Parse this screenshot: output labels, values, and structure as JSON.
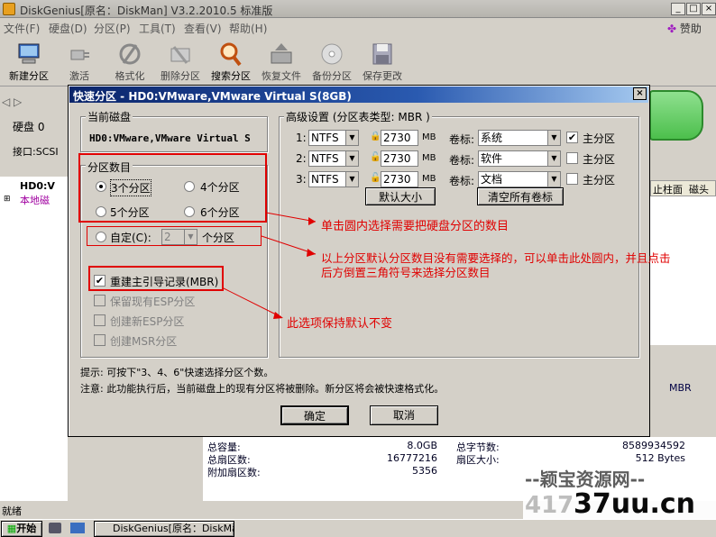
{
  "app": {
    "title": "DiskGenius[原名：DiskMan] V3.2.2010.5 标准版",
    "help": "赞助"
  },
  "menu": [
    "文件(F)",
    "硬盘(D)",
    "分区(P)",
    "工具(T)",
    "查看(V)",
    "帮助(H)"
  ],
  "toolbar": [
    "新建分区",
    "激活",
    "格式化",
    "删除分区",
    "搜索分区",
    "恢复文件",
    "备份分区",
    "保存更改"
  ],
  "left": {
    "disk_label": "硬盘 0",
    "iface": "接口:SCSI",
    "tree1": "HD0:V",
    "tree2": "本地磁"
  },
  "right_headers": {
    "col1": "止柱面",
    "col2": "磁头"
  },
  "info": {
    "mbr": "MBR",
    "rows": [
      {
        "k": "总容量:",
        "v": "8.0GB",
        "k2": "总字节数:",
        "v2": "8589934592"
      },
      {
        "k": "总扇区数:",
        "v": "16777216",
        "k2": "扇区大小:",
        "v2": "512 Bytes"
      },
      {
        "k": "附加扇区数:",
        "v": "5356",
        "k2": "",
        "v2": ""
      }
    ]
  },
  "status": "就绪",
  "taskbar": {
    "start": "开始",
    "task": "DiskGenius[原名：DiskMan"
  },
  "watermark": {
    "top": "--颖宝资源网--",
    "bottom": "37uu.cn",
    "num": "417"
  },
  "dialog": {
    "title": "快速分区 - HD0:VMware,VMware Virtual S(8GB)",
    "current_disk_label": "当前磁盘",
    "current_disk": "HD0:VMware,VMware Virtual S",
    "count_label": "分区数目",
    "opt3": "3个分区",
    "opt4": "4个分区",
    "opt5": "5个分区",
    "opt6": "6个分区",
    "custom": "自定(C):",
    "custom_val": "2",
    "custom_unit": "个分区",
    "mbr": "重建主引导记录(MBR)",
    "esp_keep": "保留现有ESP分区",
    "esp_new": "创建新ESP分区",
    "msr": "创建MSR分区",
    "adv_label": "高级设置 (分区表类型: MBR )",
    "parts": [
      {
        "n": "1:",
        "fs": "NTFS",
        "size": "2730",
        "unit": "MB",
        "vol_label": "卷标:",
        "vol": "系统",
        "primary": "主分区",
        "checked": true
      },
      {
        "n": "2:",
        "fs": "NTFS",
        "size": "2730",
        "unit": "MB",
        "vol_label": "卷标:",
        "vol": "软件",
        "primary": "主分区",
        "checked": false
      },
      {
        "n": "3:",
        "fs": "NTFS",
        "size": "2730",
        "unit": "MB",
        "vol_label": "卷标:",
        "vol": "文档",
        "primary": "主分区",
        "checked": false
      }
    ],
    "default_size": "默认大小",
    "clear_labels": "清空所有卷标",
    "tip": "提示: 可按下\"3、4、6\"快速选择分区个数。",
    "note": "注意: 此功能执行后，当前磁盘上的现有分区将被删除。新分区将会被快速格式化。",
    "ok": "确定",
    "cancel": "取消"
  },
  "annotations": {
    "a1": "单击圆内选择需要把硬盘分区的数目",
    "a2": "以上分区默认分区数目没有需要选择的，可以单击此处圆内，并且点击",
    "a3": "后方倒置三角符号来选择分区数目",
    "a4": "此选项保持默认不变"
  },
  "colors": {
    "annotation": "#e00000",
    "title_bar": "#0a246a"
  }
}
